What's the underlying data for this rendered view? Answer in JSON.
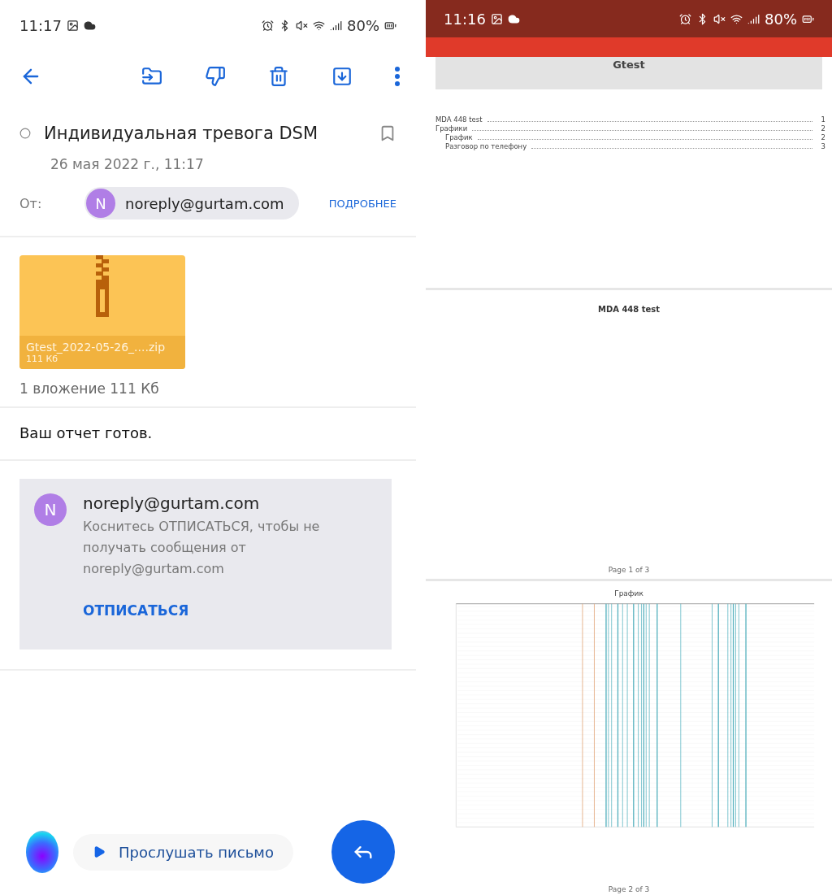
{
  "left_screen": {
    "status_bar": {
      "time": "11:17",
      "battery": "80%"
    },
    "email": {
      "subject": "Индивидуальная тревога DSM",
      "date": "26 мая 2022 г., 11:17",
      "from_label": "От:",
      "sender_initial": "N",
      "sender": "noreply@gurtam.com",
      "details_link": "ПОДРОБНЕЕ"
    },
    "attachment": {
      "name": "Gtest_2022-05-26_....zip",
      "size": "111  Кб"
    },
    "attachments_summary": "1 вложение 111  Кб",
    "body": "Ваш отчет готов.",
    "unsubscribe_card": {
      "initial": "N",
      "sender": "noreply@gurtam.com",
      "text": "Коснитесь ОТПИСАТЬСЯ, чтобы не получать сообщения от noreply@gurtam.com",
      "action": "ОТПИСАТЬСЯ"
    },
    "listen_button": "Прослушать письмо"
  },
  "right_screen": {
    "status_bar": {
      "time": "11:16",
      "battery": "80%"
    },
    "document": {
      "title": "Gtest",
      "toc": [
        {
          "title": "MDA 448 test",
          "page": "1"
        },
        {
          "title": "Графики",
          "page": "2",
          "children": [
            {
              "title": "График",
              "page": "2"
            },
            {
              "title": "Разговор по телефону",
              "page": "3"
            }
          ]
        }
      ],
      "page1_heading": "MDA 448 test",
      "page1_footer": "Page 1 of 3",
      "chart_title": "График",
      "page2_footer": "Page 2 of 3"
    }
  }
}
